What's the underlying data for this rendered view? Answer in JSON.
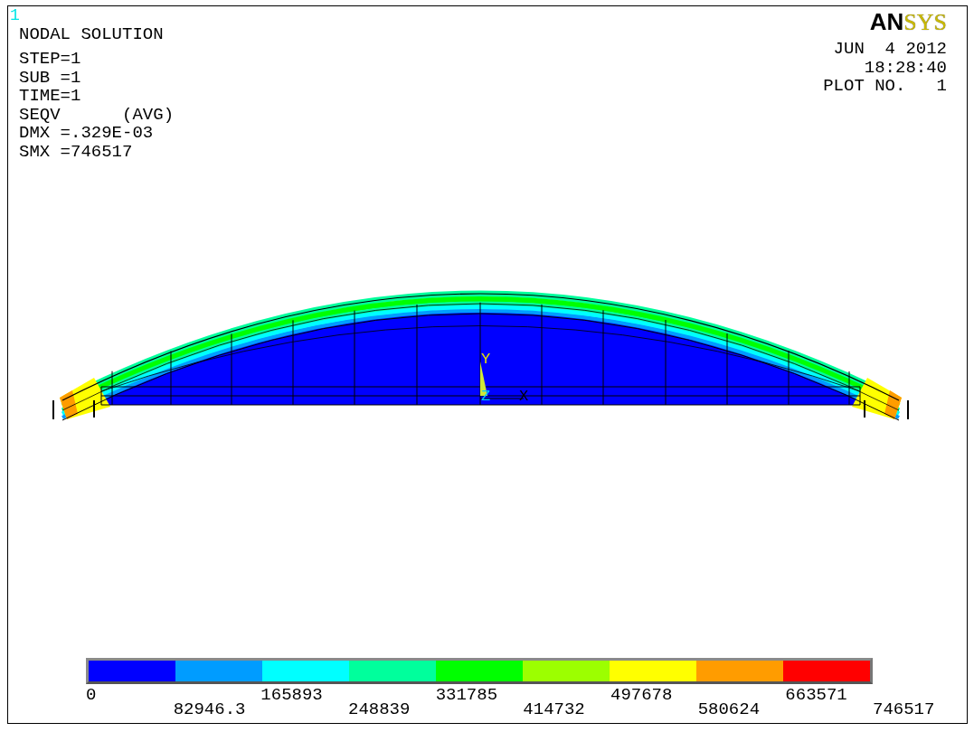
{
  "window_number": "1",
  "title": "NODAL SOLUTION",
  "info_lines": [
    "STEP=1",
    "SUB =1",
    "TIME=1",
    "SEQV      (AVG)",
    "DMX =.329E-03",
    "SMX =746517"
  ],
  "logo": {
    "part_1": "AN",
    "part_2": "SYS"
  },
  "stamp": {
    "date": "JUN  4 2012",
    "time": "18:28:40",
    "plot_no": "PLOT NO.   1"
  },
  "triad": {
    "y_label": "Y",
    "x_label": "X",
    "z_label": "Z"
  },
  "legend": {
    "segments": [
      {
        "color": "#0000ff"
      },
      {
        "color": "#009cff"
      },
      {
        "color": "#00ffff"
      },
      {
        "color": "#00ff9c"
      },
      {
        "color": "#00ff00"
      },
      {
        "color": "#9cff00"
      },
      {
        "color": "#ffff00"
      },
      {
        "color": "#ff9c00"
      },
      {
        "color": "#ff0000"
      }
    ],
    "labels": [
      "0",
      "82946.3",
      "165893",
      "248839",
      "331785",
      "414732",
      "497678",
      "580624",
      "663571",
      "746517"
    ]
  }
}
